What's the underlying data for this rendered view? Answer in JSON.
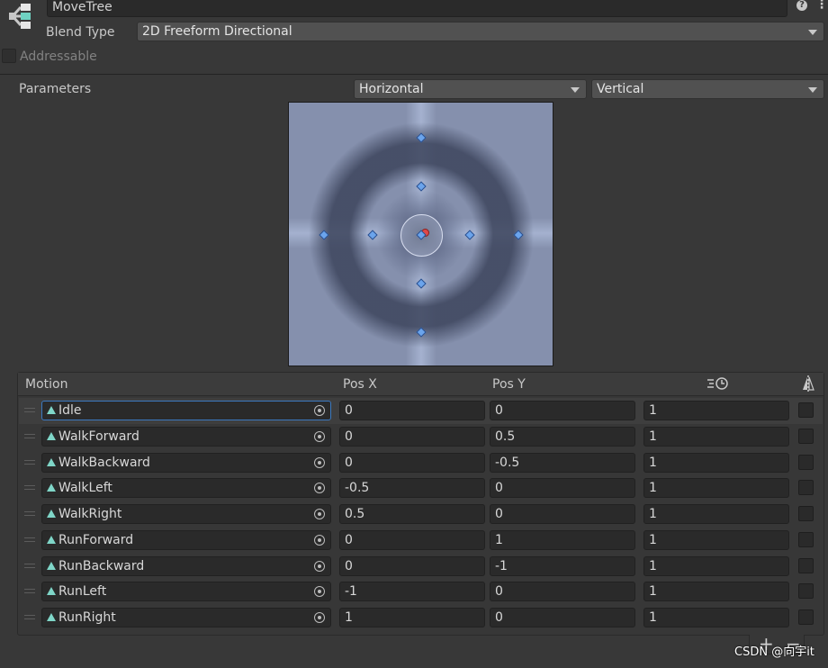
{
  "header": {
    "name_value": "MoveTree",
    "blend_type_label": "Blend Type",
    "blend_type_value": "2D Freeform Directional",
    "addressable_label": "Addressable"
  },
  "parameters": {
    "label": "Parameters",
    "x_param": "Horizontal",
    "y_param": "Vertical"
  },
  "table": {
    "headers": {
      "motion": "Motion",
      "pos_x": "Pos X",
      "pos_y": "Pos Y"
    },
    "rows": [
      {
        "motion": "Idle",
        "pos_x": "0",
        "pos_y": "0",
        "speed": "1"
      },
      {
        "motion": "WalkForward",
        "pos_x": "0",
        "pos_y": "0.5",
        "speed": "1"
      },
      {
        "motion": "WalkBackward",
        "pos_x": "0",
        "pos_y": "-0.5",
        "speed": "1"
      },
      {
        "motion": "WalkLeft",
        "pos_x": "-0.5",
        "pos_y": "0",
        "speed": "1"
      },
      {
        "motion": "WalkRight",
        "pos_x": "0.5",
        "pos_y": "0",
        "speed": "1"
      },
      {
        "motion": "RunForward",
        "pos_x": "0",
        "pos_y": "1",
        "speed": "1"
      },
      {
        "motion": "RunBackward",
        "pos_x": "0",
        "pos_y": "-1",
        "speed": "1"
      },
      {
        "motion": "RunLeft",
        "pos_x": "-1",
        "pos_y": "0",
        "speed": "1"
      },
      {
        "motion": "RunRight",
        "pos_x": "1",
        "pos_y": "0",
        "speed": "1"
      }
    ]
  },
  "watermark": "CSDN @向宇it",
  "colors": {
    "point": "#6ba4ec",
    "current_point": "#e04848",
    "selected_outline": "#3b79c0"
  }
}
